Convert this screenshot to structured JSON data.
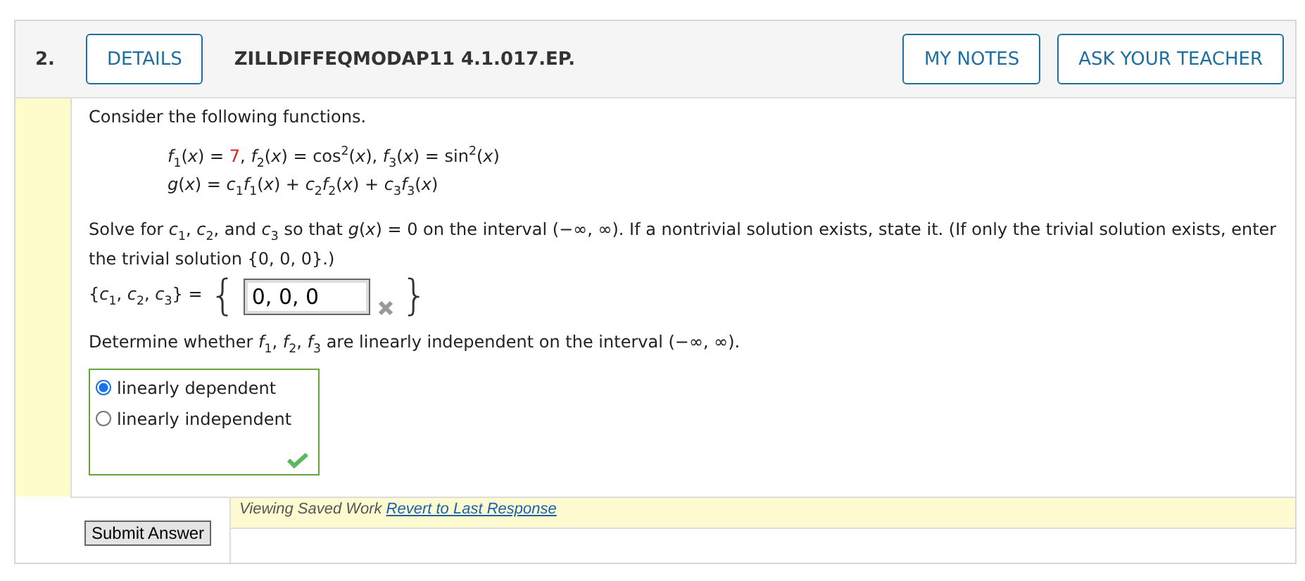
{
  "question": {
    "number": "2.",
    "details_button": "DETAILS",
    "code": "ZILLDIFFEQMODAP11 4.1.017.EP.",
    "my_notes_button": "MY NOTES",
    "ask_teacher_button": "ASK YOUR TEACHER"
  },
  "intro": "Consider the following functions.",
  "formula_lines": [
    [
      {
        "kind": "math",
        "text": "*f*$_{1}$(*x*) = "
      },
      {
        "kind": "given",
        "text": "7"
      },
      {
        "kind": "math",
        "text": ", *f*$_{2}$(*x*) = cos$^{2}$(*x*), *f*$_{3}$(*x*) = sin$^{2}$(*x*)"
      }
    ],
    [
      {
        "kind": "math",
        "text": "*g*(*x*) = *c*$_{1}$*f*$_{1}$(*x*) + *c*$_{2}$*f*$_{2}$(*x*) + *c*$_{3}$*f*$_{3}$(*x*)"
      }
    ]
  ],
  "prompt": "Solve for *c*$_{1}$, *c*$_{2}$, and *c*$_{3}$ so that *g*(*x*) = 0 on the interval (−∞, ∞). If a nontrivial solution exists, state it. (If only the trivial solution exists, enter the trivial solution {0, 0, 0}.)",
  "answer": {
    "label": "{*c*$_{1}$, *c*$_{2}$, *c*$_{3}$} =",
    "open_brace": "{",
    "value": "0, 0, 0",
    "close_brace": "}",
    "correct": false
  },
  "question2": "Determine whether *f*$_{1}$, *f*$_{2}$, *f*$_{3}$ are linearly independent on the interval (−∞, ∞).",
  "options": [
    {
      "label": "linearly dependent",
      "selected": true
    },
    {
      "label": "linearly independent",
      "selected": false
    }
  ],
  "options_correct": true,
  "submit_button": "Submit Answer",
  "status": {
    "text": "Viewing Saved Work",
    "link": "Revert to Last Response"
  }
}
